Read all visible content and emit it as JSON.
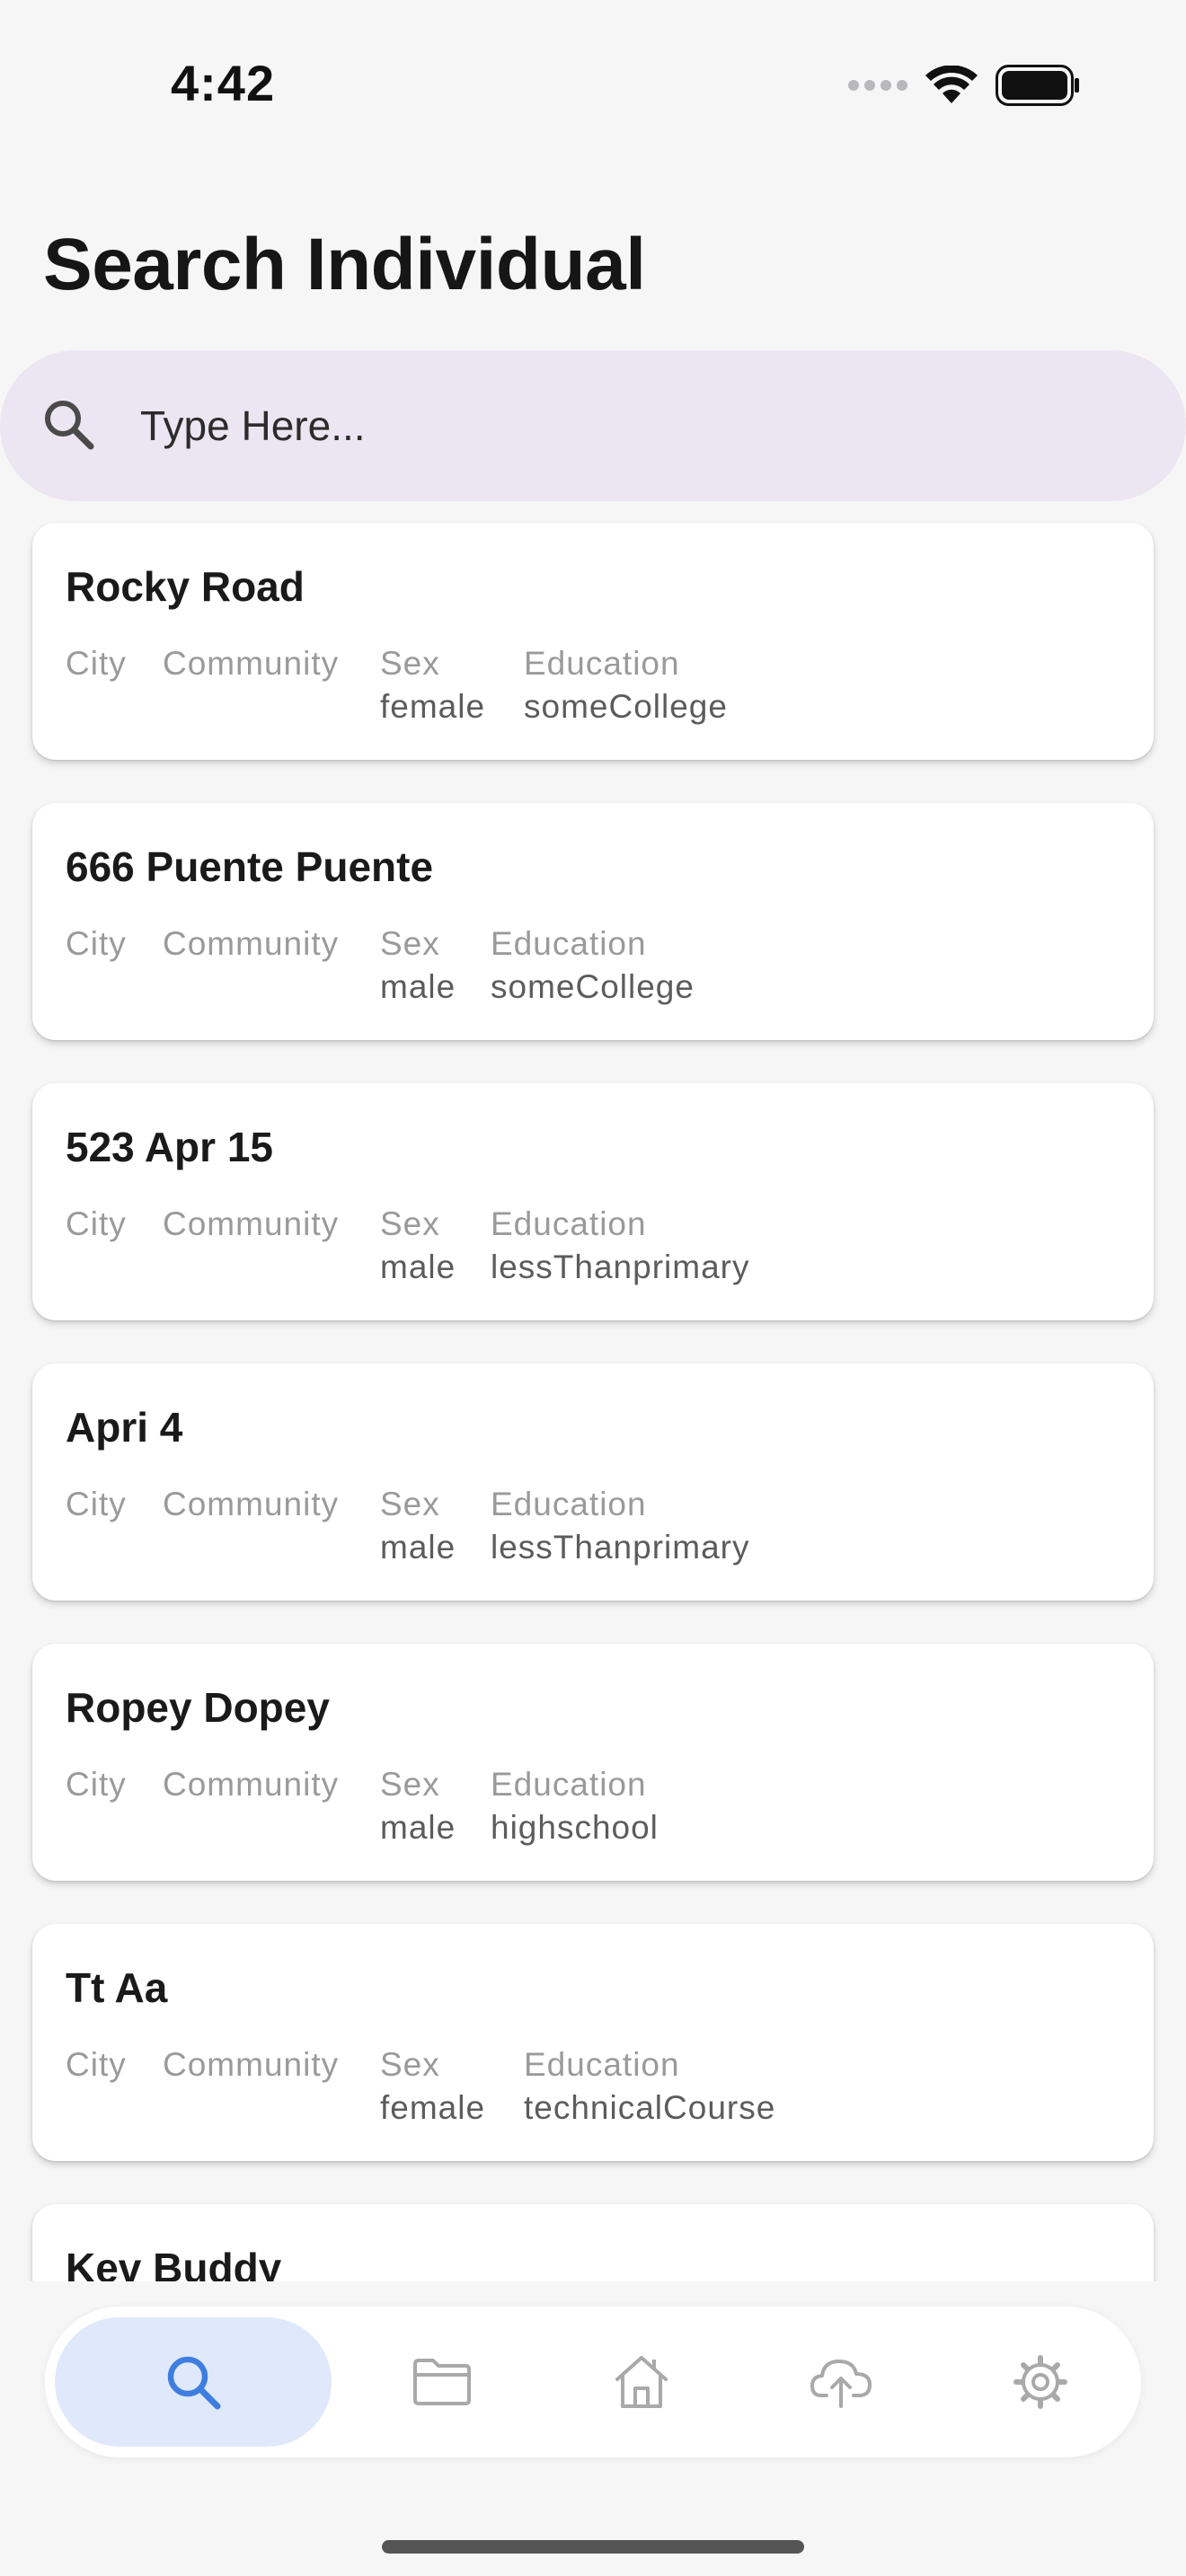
{
  "status_bar": {
    "time": "4:42",
    "icons": [
      "cellular-signal-icon",
      "wifi-icon",
      "battery-icon"
    ]
  },
  "page": {
    "title": "Search Individual"
  },
  "search": {
    "placeholder": "Type Here...",
    "value": ""
  },
  "labels": {
    "city": "City",
    "community": "Community",
    "sex": "Sex",
    "education": "Education"
  },
  "individuals": [
    {
      "name": "Rocky Road",
      "city": "",
      "community": "",
      "sex": "female",
      "education": "someCollege"
    },
    {
      "name": "666 Puente Puente",
      "city": "",
      "community": "",
      "sex": "male",
      "education": "someCollege"
    },
    {
      "name": "523 Apr 15",
      "city": "",
      "community": "",
      "sex": "male",
      "education": "lessThanprimary"
    },
    {
      "name": "Apri 4",
      "city": "",
      "community": "",
      "sex": "male",
      "education": "lessThanprimary"
    },
    {
      "name": "Ropey Dopey",
      "city": "",
      "community": "",
      "sex": "male",
      "education": "highschool"
    },
    {
      "name": "Tt Aa",
      "city": "",
      "community": "",
      "sex": "female",
      "education": "technicalCourse"
    },
    {
      "name": "Kev Buddy",
      "city": "",
      "community": "",
      "sex": "",
      "education": ""
    }
  ],
  "bottom_nav": {
    "active": "search",
    "items": [
      {
        "id": "search",
        "icon": "search-icon"
      },
      {
        "id": "folder",
        "icon": "folder-icon"
      },
      {
        "id": "home",
        "icon": "home-icon"
      },
      {
        "id": "upload",
        "icon": "cloud-upload-icon"
      },
      {
        "id": "settings",
        "icon": "gear-icon"
      }
    ]
  },
  "colors": {
    "background": "#f6f6f6",
    "search_bar": "#ebe6f1",
    "active_nav": "#dfe9fb",
    "accent": "#3f7de0",
    "muted_icon": "#a9a9a9"
  }
}
